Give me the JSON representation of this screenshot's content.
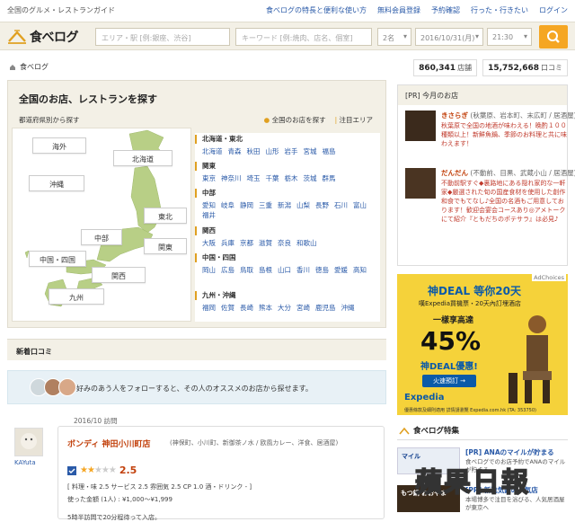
{
  "top": {
    "tagline": "全国のグルメ・レストランガイド",
    "nav": [
      "食べログの特長と便利な使い方",
      "無料会員登録",
      "予約確認",
      "行った・行きたい",
      "ログイン"
    ]
  },
  "header": {
    "logo_text": "食べログ",
    "area_placeholder": "エリア・駅 [例:銀座、渋谷]",
    "keyword_placeholder": "キーワード [例:焼肉、店名、個室]",
    "people": "2名",
    "date": "2016/10/31(月)",
    "time": "21:30"
  },
  "breadcrumb": {
    "home": "食べログ"
  },
  "counts": [
    {
      "value": "860,341",
      "unit": "店舗"
    },
    {
      "value": "15,752,668",
      "unit": "口コミ"
    }
  ],
  "search_panel": {
    "title": "全国のお店、レストランを探す",
    "sub": "都道府県別から探す",
    "link_all": "全国のお店を探す",
    "link_popular": "注目エリア",
    "map_regions": [
      "海外",
      "北海道",
      "沖縄",
      "東北",
      "中部",
      "関東",
      "中国・四国",
      "関西",
      "九州"
    ],
    "regions": [
      {
        "title": "北海道・東北",
        "prefs": [
          "北海道",
          "青森",
          "秋田",
          "山形",
          "岩手",
          "宮城",
          "福島"
        ]
      },
      {
        "title": "関東",
        "prefs": [
          "東京",
          "神奈川",
          "埼玉",
          "千葉",
          "栃木",
          "茨城",
          "群馬"
        ]
      },
      {
        "title": "中部",
        "prefs": [
          "愛知",
          "岐阜",
          "静岡",
          "三重",
          "新潟",
          "山梨",
          "長野",
          "石川",
          "富山",
          "福井"
        ]
      },
      {
        "title": "関西",
        "prefs": [
          "大阪",
          "兵庫",
          "京都",
          "滋賀",
          "奈良",
          "和歌山"
        ]
      },
      {
        "title": "中国・四国",
        "prefs": [
          "岡山",
          "広島",
          "鳥取",
          "島根",
          "山口",
          "香川",
          "徳島",
          "愛媛",
          "高知"
        ]
      },
      {
        "title": "九州・沖縄",
        "prefs": [
          "福岡",
          "佐賀",
          "長崎",
          "熊本",
          "大分",
          "宮崎",
          "鹿児島",
          "沖縄"
        ]
      }
    ]
  },
  "new_reviews": {
    "title": "新着口コミ",
    "follow_text": "好みのあう人をフォローすると、その人のオススメのお店から探せます。",
    "review": {
      "date": "2016/10 訪問",
      "user": "KAYuta",
      "shop_name": "ボンディ 神田小川町店",
      "meta": "(神保町、小川町、新御茶ノ水 / 欧風カレー、洋食、居酒屋)",
      "score": "2.5",
      "breakdown": "[ 料理・味 2.5 サービス 2.5 雰囲気 2.5 CP 1.0 酒・ドリンク - ]",
      "price_label": "使った金額 (1人) :",
      "price": "¥1,000～¥1,999",
      "note": "5時半訪問で20分程待って入店。"
    }
  },
  "pr": {
    "title": "[PR] 今月のお店",
    "items": [
      {
        "name": "きさらぎ",
        "area": "(秋葉原、岩本町、末広町 / 居酒屋)",
        "desc": "秋葉原で全国の地酒が味わえる！晩酌１００種類以上！新鮮魚鍋、季節のお料理と共に味わえます！"
      },
      {
        "name": "だんだん",
        "area": "(不動前、目黒、武蔵小山 / 居酒屋)",
        "desc": "不動前駅すぐ◆裏路地にある隠れ家的な一軒家◆厳選された旬の国産食材を使用した創作和食でもてなし♪全国の名酒もご用意しております！歓迎会宴会コースあり◎アメトークにて紹介『ともだちのポテサラ』は必見♪"
      }
    ]
  },
  "ad": {
    "choices": "AdChoices",
    "headline": "神DEAL 等你20天",
    "sub": "嘆Expedia買機票・20天內訂埋酒店",
    "lead": "一樣享高達",
    "big": "45%",
    "deal": "神DEAL優惠!",
    "button": "火速預訂 →",
    "brand": "Expedia",
    "fine": "優惠條款及細則適用 詳情請瀏覽 Expedia.com.hk (TA: 353750)"
  },
  "features": {
    "title": "食べログ特集",
    "items": [
      {
        "title": "[PR] ANAのマイルが貯まる",
        "desc": "食べログでのお店予約でANAのマイルが貯まる"
      },
      {
        "title": "[PR] 新進気鋭の人気店",
        "desc": "本場博多で注目を浴びる、人気居酒屋が東京へ"
      }
    ],
    "thumb_labels": [
      "マイル",
      "もつ鍋 おおやま"
    ]
  },
  "watermark": "蘋果日報",
  "colors": {
    "accent": "#f5a623",
    "link": "#2a5aa8",
    "shop_name": "#c2410c",
    "panel": "#f3f0e6"
  }
}
